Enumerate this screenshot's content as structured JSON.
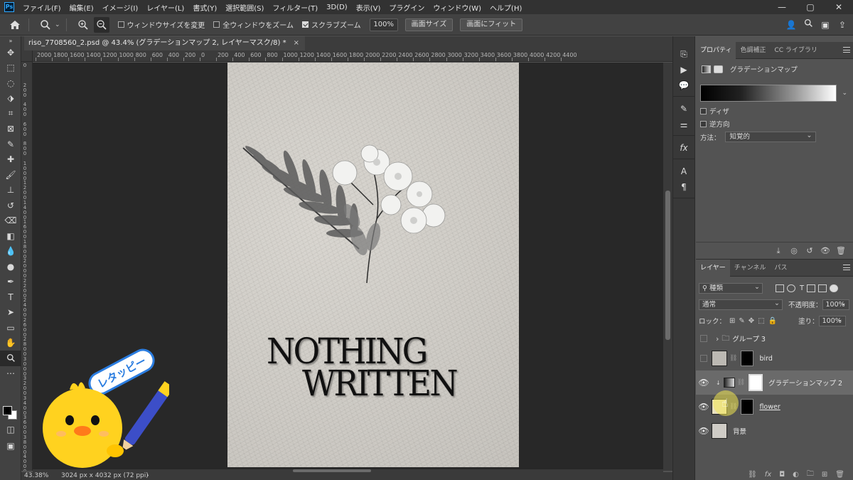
{
  "app": {
    "logo_text": "Ps",
    "menu": [
      "ファイル(F)",
      "編集(E)",
      "イメージ(I)",
      "レイヤー(L)",
      "書式(Y)",
      "選択範囲(S)",
      "フィルター(T)",
      "3D(D)",
      "表示(V)",
      "プラグイン",
      "ウィンドウ(W)",
      "ヘルプ(H)"
    ],
    "window_controls": [
      "—",
      "▢",
      "✕"
    ]
  },
  "options_bar": {
    "resize_windows_label": "ウィンドウサイズを変更",
    "zoom_all_label": "全ウィンドウをズーム",
    "scrubby_zoom_label": "スクラブズーム",
    "zoom_value": "100%",
    "fit_screen_label": "画面サイズ",
    "fill_screen_label": "画面にフィット"
  },
  "document": {
    "tab_title": "riso_7708560_2.psd @ 43.4% (グラデーションマップ 2, レイヤーマスク/8) *",
    "tab_close": "×",
    "poster_line1": "NOTHING",
    "poster_line2": "WRITTEN"
  },
  "rulers": {
    "top": [
      "2000",
      "1800",
      "1600",
      "1400",
      "1200",
      "1000",
      "800",
      "600",
      "400",
      "200",
      "0",
      "200",
      "400",
      "600",
      "800",
      "1000",
      "1200",
      "1400",
      "1600",
      "1800",
      "2000",
      "2200",
      "2400",
      "2600",
      "2800",
      "3000",
      "3200",
      "3400",
      "3600",
      "3800",
      "4000",
      "4200",
      "4400"
    ],
    "left": [
      "0",
      "200",
      "400",
      "600",
      "800",
      "1000",
      "1200",
      "1400",
      "1600",
      "1800",
      "2000",
      "2200",
      "2400",
      "2600",
      "2800",
      "3000",
      "3200",
      "3400",
      "3600",
      "3800",
      "4000"
    ]
  },
  "status_bar": {
    "zoom": "43.38%",
    "doc_info": "3024 px x 4032 px (72 ppi)",
    "arrow": "›"
  },
  "properties_panel": {
    "tabs": [
      "プロパティ",
      "色調補正",
      "CC ライブラリ"
    ],
    "header": "グラデーションマップ",
    "dither_label": "ディザ",
    "reverse_label": "逆方向",
    "method_label": "方法：",
    "method_value": "知覚的"
  },
  "layers_panel": {
    "tabs": [
      "レイヤー",
      "チャンネル",
      "パス"
    ],
    "filter_kind": "種類",
    "blend_mode": "通常",
    "opacity_label": "不透明度：",
    "opacity_value": "100%",
    "lock_label": "ロック：",
    "fill_label": "塗り：",
    "fill_value": "100%",
    "layers": [
      {
        "name": "グループ 3",
        "visible": false
      },
      {
        "name": "bird",
        "visible": false
      },
      {
        "name": "グラデーションマップ 2",
        "visible": true
      },
      {
        "name": "flower",
        "visible": true
      },
      {
        "name": "背景",
        "visible": true
      }
    ]
  },
  "mascot": {
    "speech_text": "レタッピー"
  },
  "colors": {
    "accent": "#31a8ff",
    "canvas_bg": "#282828",
    "panel_bg": "#535353"
  }
}
